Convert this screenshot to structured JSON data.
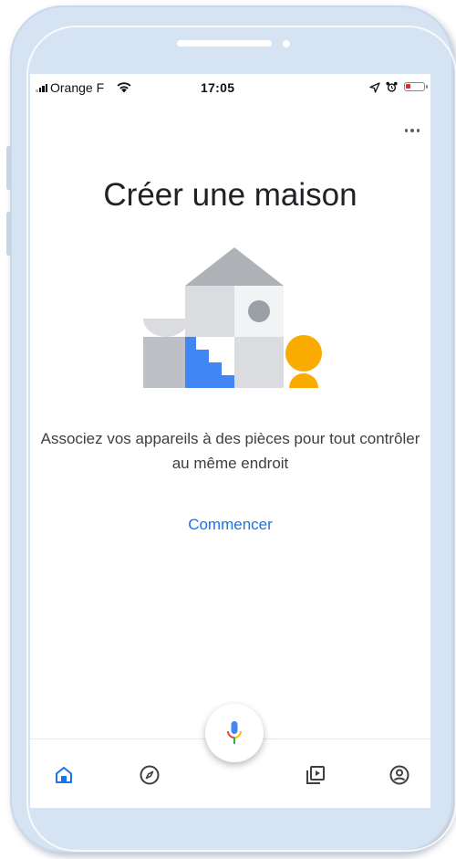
{
  "status_bar": {
    "carrier": "Orange F",
    "time": "17:05",
    "battery_level": 0.25,
    "battery_color": "#e8272a"
  },
  "header": {
    "more_icon": "more-horiz-icon"
  },
  "main": {
    "title": "Créer une maison",
    "description": "Associez vos appareils à des pièces pour tout contrôler au même endroit",
    "start_label": "Commencer",
    "illustration": "house-illustration"
  },
  "assistant": {
    "icon": "microphone-icon"
  },
  "bottom_nav": {
    "active_index": 0,
    "items": [
      {
        "icon": "home-icon"
      },
      {
        "icon": "compass-icon"
      },
      {
        "icon": "media-library-icon"
      },
      {
        "icon": "account-icon"
      }
    ]
  },
  "colors": {
    "accent": "#1a73e8",
    "inactive_icon": "#3c4043",
    "illustration_yellow": "#f9ab00",
    "illustration_blue": "#4285f4"
  }
}
